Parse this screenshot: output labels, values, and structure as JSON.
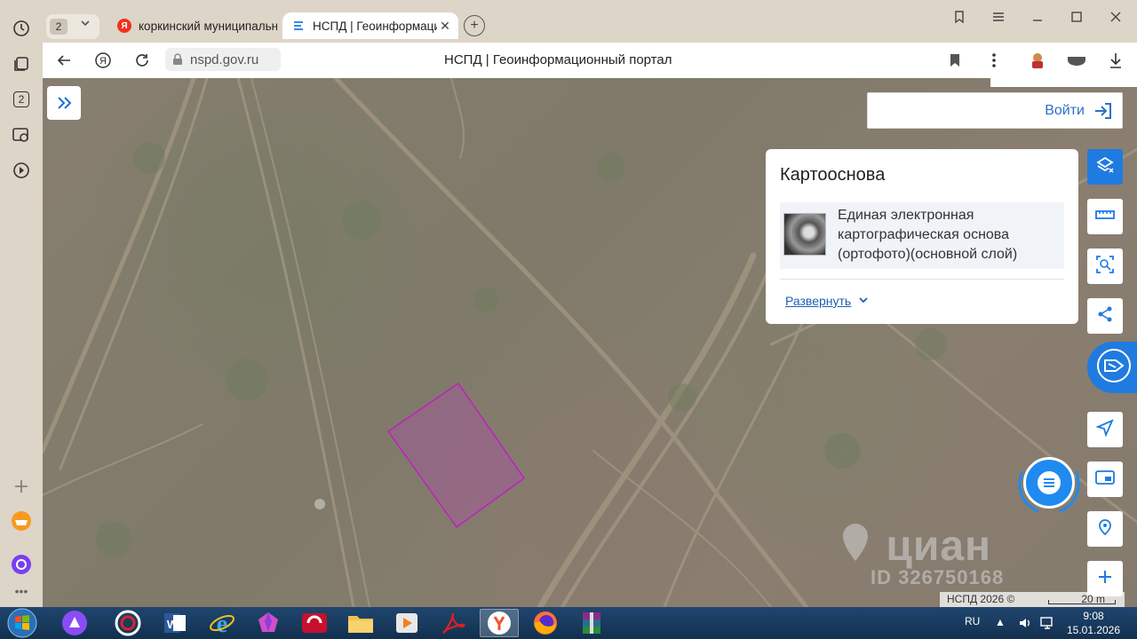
{
  "browser": {
    "tab_count": "2",
    "tabs": [
      {
        "title": "коркинский муниципальный округ",
        "favicon": "yandex-icon"
      },
      {
        "title": "НСПД | Геоинформационный портал",
        "favicon": "nspd-icon"
      }
    ],
    "url": "nspd.gov.ru",
    "page_title": "НСПД | Геоинформационный портал",
    "sidebar_badge": "2"
  },
  "map": {
    "login_label": "Войти",
    "basemap_panel": {
      "title": "Картооснова",
      "layer_name": "Единая электронная картографическая основа (ортофото)(основной слой)",
      "expand_label": "Развернуть"
    },
    "watermark": "циан",
    "watermark_id": "ID 326750168",
    "attribution": "НСПД 2026 ©",
    "scale_label": "20 m"
  },
  "taskbar": {
    "language": "RU",
    "time": "9:08",
    "date": "15.01.2026"
  },
  "colors": {
    "accent": "#1f7be0",
    "parcel": "#c020c0"
  }
}
